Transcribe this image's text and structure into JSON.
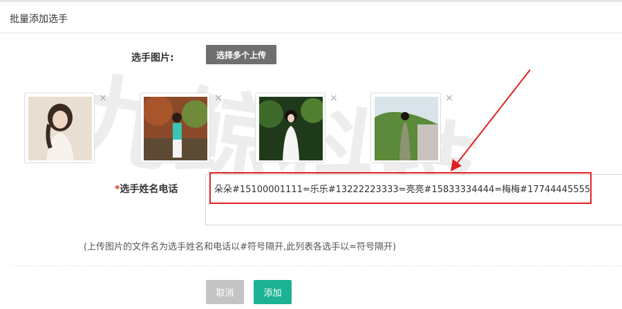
{
  "header": {
    "title": "批量添加选手"
  },
  "watermark": {
    "text": "九鲸科技"
  },
  "upload": {
    "label": "选手图片:",
    "button_label": "选择多个上传"
  },
  "thumbnails": [
    {
      "remove_icon": "×"
    },
    {
      "remove_icon": "×"
    },
    {
      "remove_icon": "×"
    },
    {
      "remove_icon": "×"
    }
  ],
  "names": {
    "required_mark": "*",
    "label": "选手姓名电话",
    "value": "朵朵#15100001111=乐乐#13222223333=亮亮#15833334444=梅梅#17744445555"
  },
  "hint": "(上传图片的文件名为选手姓名和电话以#符号隔开,此列表各选手以=符号隔开)",
  "actions": {
    "cancel_label": "取消",
    "add_label": "添加"
  },
  "colors": {
    "add_button": "#1cb394",
    "cancel_button": "#c4c4c4",
    "upload_button": "#6f6f6f",
    "annotation": "#e02020"
  }
}
